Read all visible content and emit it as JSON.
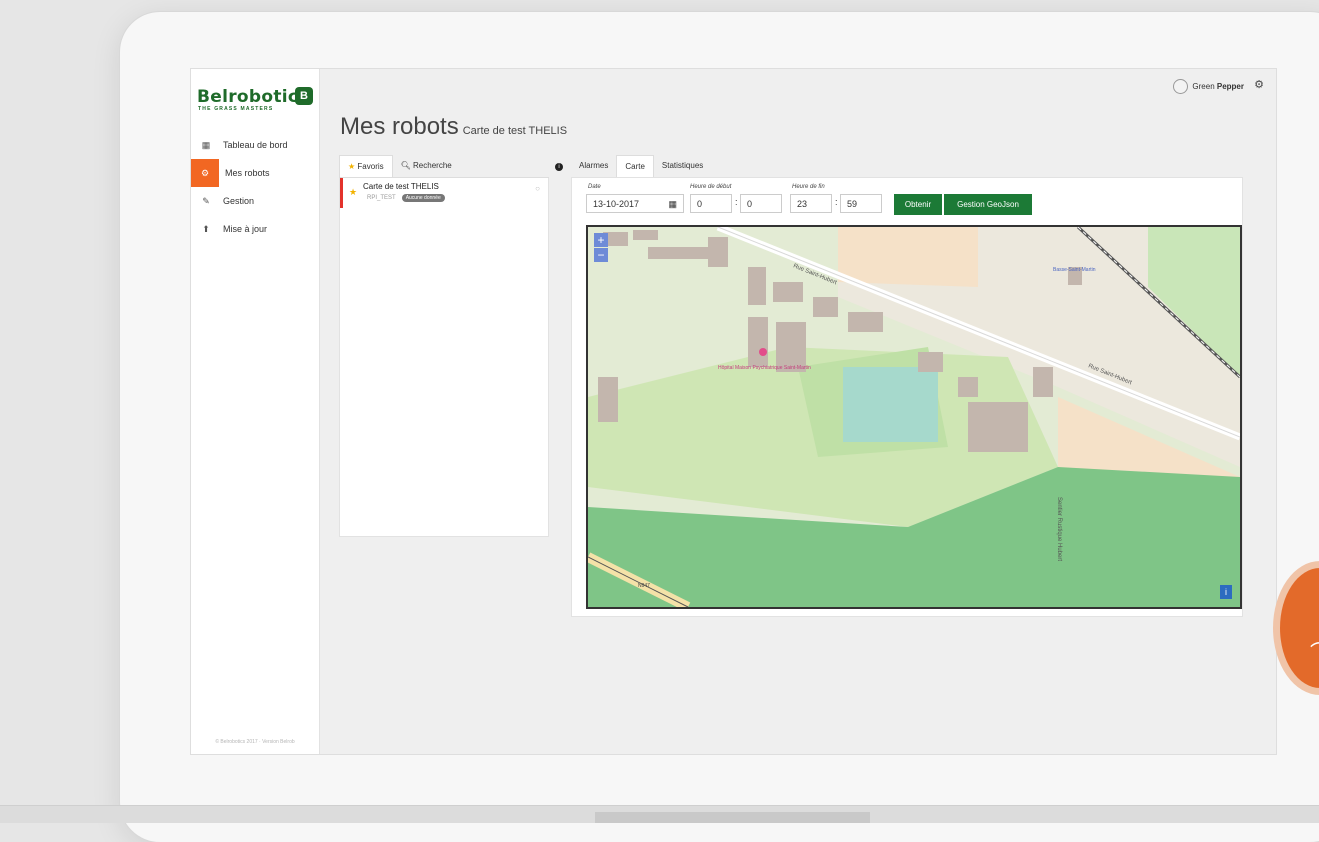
{
  "brand": {
    "name": "Belrobotics",
    "tagline": "THE GRASS MASTERS",
    "mark": "B"
  },
  "sidebar": {
    "items": [
      {
        "label": "Tableau de bord",
        "icon": "grid-icon"
      },
      {
        "label": "Mes robots",
        "icon": "robots-icon"
      },
      {
        "label": "Gestion",
        "icon": "wrench-icon"
      },
      {
        "label": "Mise à jour",
        "icon": "upload-icon"
      }
    ],
    "footer": "© Belrobotics 2017 · Version Belrob"
  },
  "user": {
    "first": "Green",
    "last": "Pepper"
  },
  "page": {
    "title": "Mes robots",
    "subtitle": "Carte de test THELIS"
  },
  "left_panel": {
    "tabs": [
      "Favoris",
      "Recherche"
    ],
    "robot": {
      "name": "Carte de test THELIS",
      "id": "RPI_TEST",
      "badge": "Aucune donnée"
    }
  },
  "right_panel": {
    "tabs": [
      "Alarmes",
      "Carte",
      "Statistiques"
    ],
    "date_label": "Date",
    "date_value": "13-10-2017",
    "start_label": "Heure de début",
    "start_h": "0",
    "start_m": "0",
    "end_label": "Heure de fin",
    "end_h": "23",
    "end_m": "59",
    "btn_obtain": "Obtenir",
    "btn_geojson": "Gestion GeoJson"
  },
  "map": {
    "road_1": "Rue Saint-Hubert",
    "road_2": "Rue Saint-Hubert",
    "road_3": "Sentier Rustique Hubert",
    "poi": "Hôpital Maison Psychiatrique Saint-Martin",
    "place": "Basse-Saint-Martin",
    "highway": "N947",
    "zoom_in": "+",
    "zoom_out": "−",
    "info": "i"
  },
  "colors": {
    "accent": "#f26722",
    "primary": "#1c7a36",
    "brand": "#1f6b2a"
  }
}
